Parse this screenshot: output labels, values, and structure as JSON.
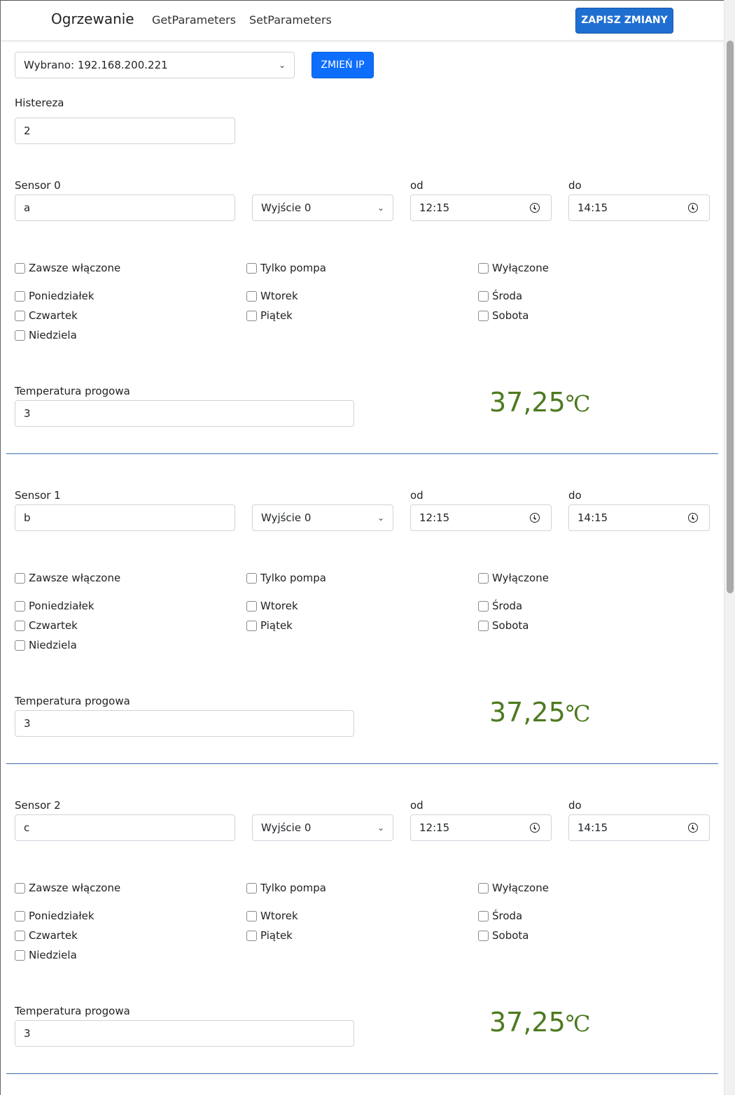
{
  "navbar": {
    "brand": "Ogrzewanie",
    "links": [
      "GetParameters",
      "SetParameters"
    ],
    "save_label": "ZAPISZ ZMIANY"
  },
  "ip": {
    "selected": "Wybrano: 192.168.200.221",
    "change_label": "ZMIEŃ IP"
  },
  "hysteresis": {
    "label": "Histereza",
    "value": "2"
  },
  "sensors": [
    {
      "label": "Sensor 0",
      "name": "a",
      "output": "Wyjście 0",
      "from_label": "od",
      "from": "12:15",
      "to_label": "do",
      "to": "14:15",
      "modes": [
        "Zawsze włączone",
        "Tylko pompa",
        "Wyłączone"
      ],
      "days": [
        "Poniedziałek",
        "Wtorek",
        "Środa",
        "Czwartek",
        "Piątek",
        "Sobota",
        "Niedziela"
      ],
      "threshold_label": "Temperatura progowa",
      "threshold": "3",
      "temperature": "37,25",
      "unit": "℃"
    },
    {
      "label": "Sensor 1",
      "name": "b",
      "output": "Wyjście 0",
      "from_label": "od",
      "from": "12:15",
      "to_label": "do",
      "to": "14:15",
      "modes": [
        "Zawsze włączone",
        "Tylko pompa",
        "Wyłączone"
      ],
      "days": [
        "Poniedziałek",
        "Wtorek",
        "Środa",
        "Czwartek",
        "Piątek",
        "Sobota",
        "Niedziela"
      ],
      "threshold_label": "Temperatura progowa",
      "threshold": "3",
      "temperature": "37,25",
      "unit": "℃"
    },
    {
      "label": "Sensor 2",
      "name": "c",
      "output": "Wyjście 0",
      "from_label": "od",
      "from": "12:15",
      "to_label": "do",
      "to": "14:15",
      "modes": [
        "Zawsze włączone",
        "Tylko pompa",
        "Wyłączone"
      ],
      "days": [
        "Poniedziałek",
        "Wtorek",
        "Środa",
        "Czwartek",
        "Piątek",
        "Sobota",
        "Niedziela"
      ],
      "threshold_label": "Temperatura progowa",
      "threshold": "3",
      "temperature": "37,25",
      "unit": "℃"
    }
  ],
  "colors": {
    "primary": "#0d6efd",
    "temperature": "#4d7a1f",
    "divider": "#3a6fb0"
  }
}
